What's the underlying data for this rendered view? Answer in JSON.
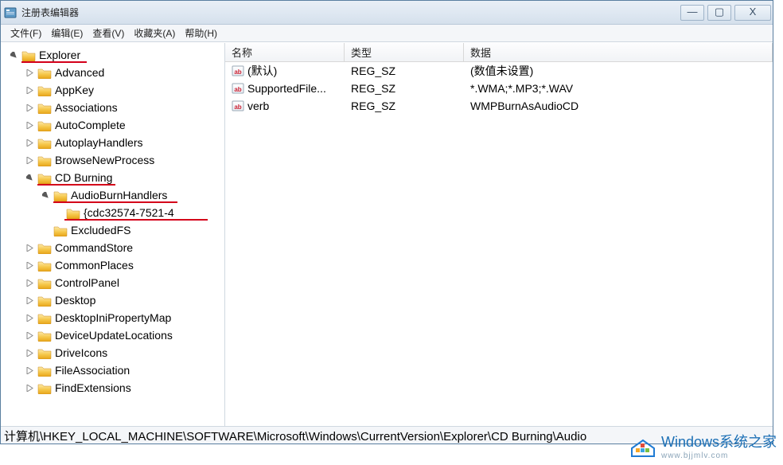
{
  "title": "注册表编辑器",
  "menu": {
    "file": "文件(F)",
    "edit": "编辑(E)",
    "view": "查看(V)",
    "fav": "收藏夹(A)",
    "help": "帮助(H)"
  },
  "tree": {
    "root": "Explorer",
    "items": [
      "Advanced",
      "AppKey",
      "Associations",
      "AutoComplete",
      "AutoplayHandlers",
      "BrowseNewProcess"
    ],
    "cd": {
      "label": "CD Burning",
      "audio": {
        "label": "AudioBurnHandlers",
        "guid": "{cdc32574-7521-4"
      },
      "excluded": "ExcludedFS"
    },
    "after": [
      "CommandStore",
      "CommonPlaces",
      "ControlPanel",
      "Desktop",
      "DesktopIniPropertyMap",
      "DeviceUpdateLocations",
      "DriveIcons",
      "FileAssociation",
      "FindExtensions"
    ]
  },
  "list": {
    "headers": {
      "name": "名称",
      "type": "类型",
      "data": "数据"
    },
    "rows": [
      {
        "name": "(默认)",
        "type": "REG_SZ",
        "data": "(数值未设置)"
      },
      {
        "name": "SupportedFile...",
        "type": "REG_SZ",
        "data": "*.WMA;*.MP3;*.WAV"
      },
      {
        "name": "verb",
        "type": "REG_SZ",
        "data": "WMPBurnAsAudioCD"
      }
    ]
  },
  "status": "计算机\\HKEY_LOCAL_MACHINE\\SOFTWARE\\Microsoft\\Windows\\CurrentVersion\\Explorer\\CD Burning\\Audio",
  "watermark": {
    "main": "Windows系统之家",
    "sub": "www.bjjmlv.com"
  }
}
